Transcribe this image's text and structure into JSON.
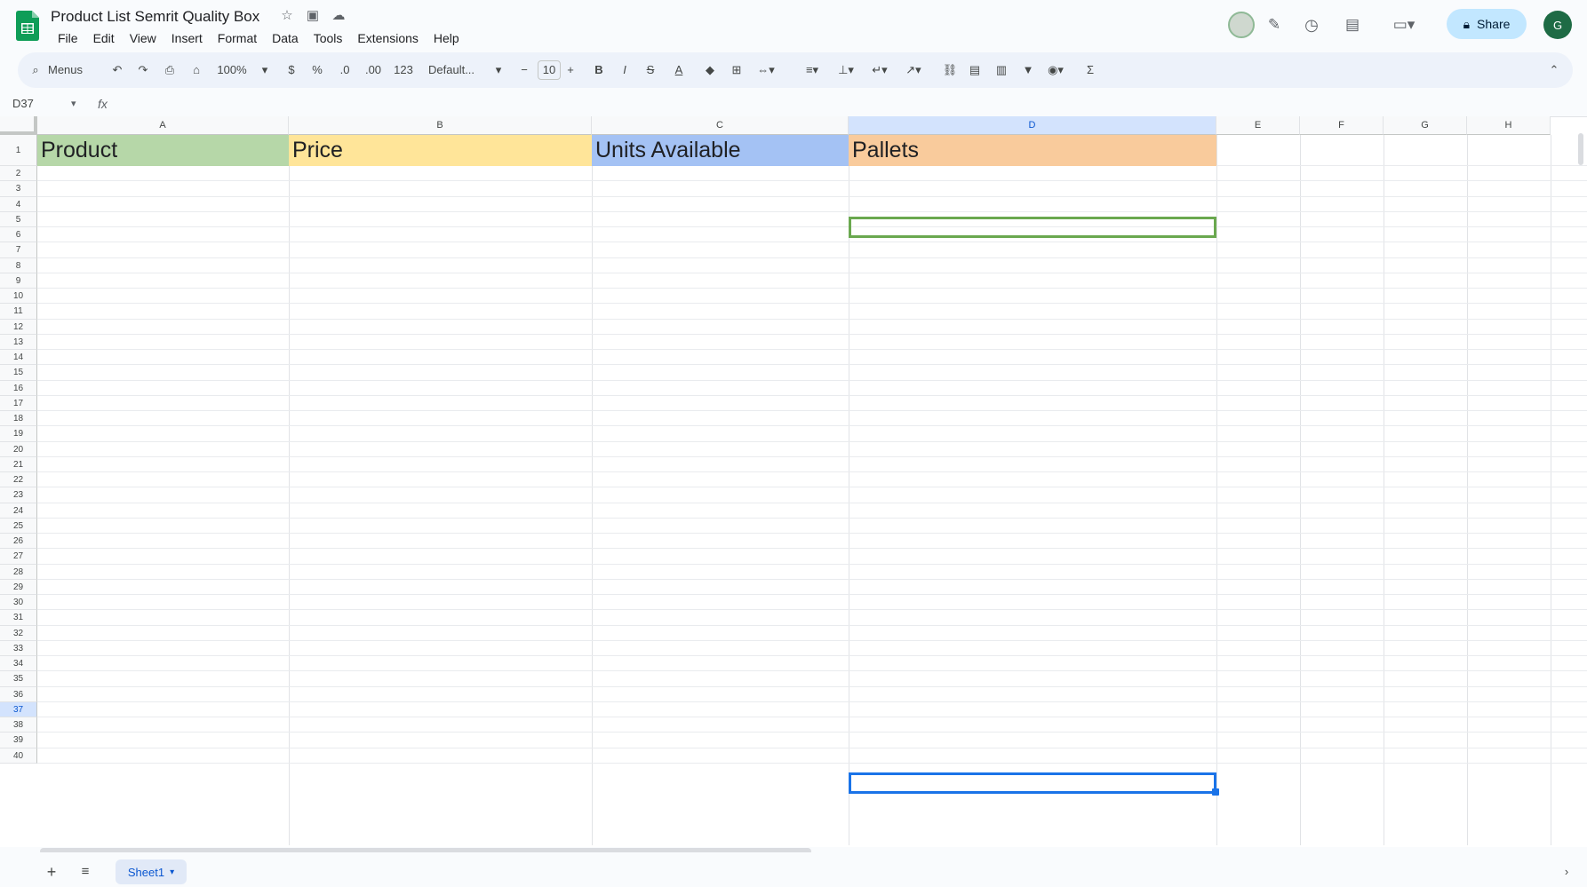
{
  "app": {
    "title": "Product List Semrit Quality Box",
    "icons": [
      "star-icon",
      "move-to-folder-icon",
      "cloud-status-icon"
    ]
  },
  "menu": [
    "File",
    "Edit",
    "View",
    "Insert",
    "Format",
    "Data",
    "Tools",
    "Extensions",
    "Help"
  ],
  "header_right": {
    "share_label": "Share",
    "avatar_initial": "G"
  },
  "toolbar": {
    "search_label": "Menus",
    "zoom": "100%",
    "currency": "$",
    "percent": "%",
    "dec_decrease": ".0",
    "dec_increase": ".00",
    "number_format": "123",
    "font": "Default...",
    "font_size": "10",
    "bold": "B",
    "italic": "I",
    "strikethrough": "S",
    "text_color": "A"
  },
  "formula_bar": {
    "name_box": "D37",
    "fx": "fx"
  },
  "columns": [
    "A",
    "B",
    "C",
    "D",
    "E",
    "F",
    "G",
    "H"
  ],
  "row_numbers": [
    "1",
    "2",
    "3",
    "4",
    "5",
    "6",
    "7",
    "8",
    "9",
    "10",
    "11",
    "12",
    "13",
    "14",
    "15",
    "16",
    "17",
    "18",
    "19",
    "20",
    "21",
    "22",
    "23",
    "24",
    "25",
    "26",
    "27",
    "28",
    "29",
    "30",
    "31",
    "32",
    "33",
    "34",
    "35",
    "36",
    "37",
    "38",
    "39",
    "40"
  ],
  "header_row": {
    "a": "Product",
    "b": "Price",
    "c": "Units Available",
    "d": "Pallets"
  },
  "colors": {
    "product_bg": "#b6d7a8",
    "price_bg": "#ffe599",
    "units_bg": "#a4c2f4",
    "pallets_bg": "#f9cb9c",
    "selection_blue": "#1a73e8",
    "highlight_green": "#6aa84f"
  },
  "sheet_tab": {
    "name": "Sheet1"
  }
}
